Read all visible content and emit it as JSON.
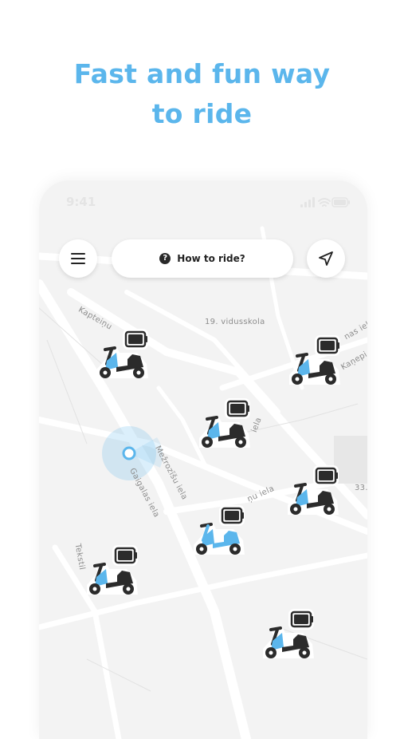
{
  "headline": {
    "line1": "Fast and fun way",
    "line2": "to ride"
  },
  "statusbar": {
    "time": "9:41"
  },
  "toolbar": {
    "menu_icon": "hamburger-menu-icon",
    "how_to_ride_label": "How to ride?",
    "help_icon": "question-circle-icon",
    "locate_icon": "navigation-arrow-icon"
  },
  "map": {
    "street_labels": [
      "Kapteiņu",
      "19. vidusskola",
      "nas iela",
      "Kaņepi",
      "ielа",
      "Mežrozīšu iela",
      "Gaigalas iela",
      "ņu iela",
      "33.",
      "Tekstil"
    ],
    "colors": {
      "accent": "#5bb6ec",
      "scooter_body": "#2b2b2b",
      "map_bg": "#f3f3f3",
      "road": "#ffffff"
    }
  },
  "scooters": [
    {
      "id": "scooter-1",
      "variant": "dark"
    },
    {
      "id": "scooter-2",
      "variant": "dark"
    },
    {
      "id": "scooter-3",
      "variant": "dark"
    },
    {
      "id": "scooter-4",
      "variant": "dark"
    },
    {
      "id": "scooter-5",
      "variant": "light"
    },
    {
      "id": "scooter-6",
      "variant": "dark"
    },
    {
      "id": "scooter-7",
      "variant": "dark"
    }
  ]
}
